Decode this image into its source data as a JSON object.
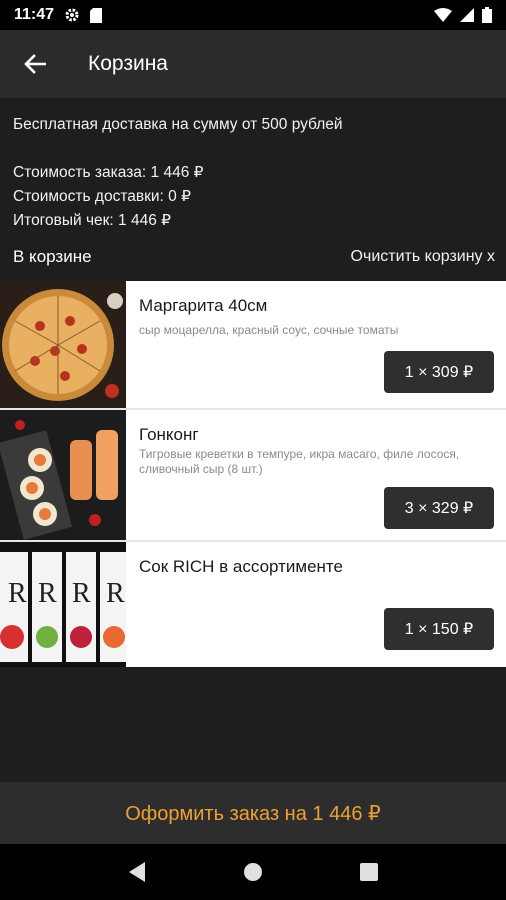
{
  "status": {
    "time": "11:47"
  },
  "header": {
    "title": "Корзина"
  },
  "info": {
    "free_delivery": "Бесплатная доставка на сумму от 500 рублей",
    "order_cost": "Стоимость заказа: 1 446 ₽",
    "delivery_cost": "Стоимость доставки: 0 ₽",
    "total": "Итоговый чек: 1 446 ₽",
    "in_cart": "В корзине",
    "clear_cart": "Очистить корзину x"
  },
  "items": [
    {
      "name": "Маргарита 40см",
      "desc": "сыр моцарелла, красный соус, сочные томаты",
      "qty": "1 × 309 ₽"
    },
    {
      "name": "Гонконг",
      "desc": "Тигровые креветки в темпуре, икра масаго, филе лосося, сливочный сыр (8 шт.)",
      "qty": "3 × 329 ₽"
    },
    {
      "name": "Сок RICH в ассортименте",
      "desc": "",
      "qty": "1 × 150 ₽"
    }
  ],
  "checkout": {
    "label": "Оформить заказ на 1 446 ₽"
  },
  "colors": {
    "accent": "#f0a030",
    "appbar": "#2b2b2b",
    "background": "#1e1e1e"
  }
}
